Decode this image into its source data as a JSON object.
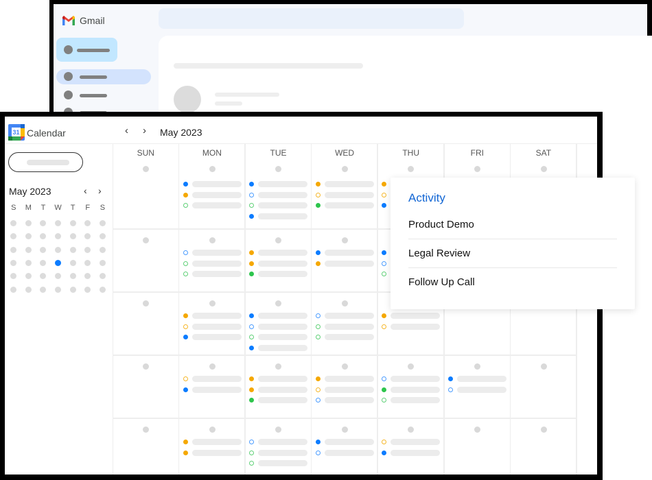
{
  "gmail": {
    "app_name": "Gmail",
    "icon": "gmail-logo-icon"
  },
  "calendar": {
    "app_name": "Calendar",
    "logo_day": "31",
    "header_month": "May 2023",
    "prev_label": "‹",
    "next_label": "›",
    "mini": {
      "month": "May 2023",
      "prev_label": "‹",
      "next_label": "›",
      "weekday_headers": [
        "S",
        "M",
        "T",
        "W",
        "T",
        "F",
        "S"
      ],
      "weeks": 6,
      "selected": {
        "week": 4,
        "weekday": 4
      }
    },
    "days": [
      "SUN",
      "MON",
      "TUE",
      "WED",
      "THU",
      "FRI",
      "SAT"
    ],
    "colors": {
      "blue": "#0b7cff",
      "orange": "#f5a800",
      "green": "#2ec54d",
      "blue_outline": "#4a9cff",
      "orange_outline": "#f5b72a",
      "green_outline": "#5fd077"
    },
    "weeks": [
      [
        [],
        [
          [
            "blue",
            "filled"
          ],
          [
            "orange",
            "filled"
          ],
          [
            "green",
            "outline"
          ]
        ],
        [
          [
            "blue",
            "filled"
          ],
          [
            "blue",
            "outline"
          ],
          [
            "green",
            "outline"
          ],
          [
            "blue",
            "filled"
          ]
        ],
        [
          [
            "orange",
            "filled"
          ],
          [
            "orange",
            "outline"
          ],
          [
            "green",
            "filled"
          ]
        ],
        [
          [
            "orange",
            "filled"
          ],
          [
            "orange",
            "outline"
          ],
          [
            "blue",
            "filled"
          ]
        ],
        [],
        []
      ],
      [
        [],
        [
          [
            "blue",
            "outline"
          ],
          [
            "green",
            "outline"
          ],
          [
            "green",
            "outline"
          ]
        ],
        [
          [
            "orange",
            "filled"
          ],
          [
            "orange",
            "filled"
          ],
          [
            "green",
            "filled"
          ]
        ],
        [
          [
            "blue",
            "filled"
          ],
          [
            "orange",
            "filled"
          ]
        ],
        [
          [
            "blue",
            "filled"
          ],
          [
            "blue",
            "outline"
          ],
          [
            "green",
            "outline"
          ]
        ],
        [],
        []
      ],
      [
        [],
        [
          [
            "orange",
            "filled"
          ],
          [
            "orange",
            "outline"
          ],
          [
            "blue",
            "filled"
          ]
        ],
        [
          [
            "blue",
            "filled"
          ],
          [
            "blue",
            "outline"
          ],
          [
            "green",
            "outline"
          ],
          [
            "blue",
            "filled"
          ]
        ],
        [
          [
            "blue",
            "outline"
          ],
          [
            "green",
            "outline"
          ],
          [
            "green",
            "outline"
          ]
        ],
        [
          [
            "orange",
            "filled"
          ],
          [
            "orange",
            "outline"
          ]
        ],
        [],
        []
      ],
      [
        [],
        [
          [
            "orange",
            "outline"
          ],
          [
            "blue",
            "filled"
          ]
        ],
        [
          [
            "orange",
            "filled"
          ],
          [
            "orange",
            "filled"
          ],
          [
            "green",
            "filled"
          ]
        ],
        [
          [
            "orange",
            "filled"
          ],
          [
            "orange",
            "outline"
          ],
          [
            "blue",
            "outline"
          ]
        ],
        [
          [
            "blue",
            "outline"
          ],
          [
            "green",
            "filled"
          ],
          [
            "green",
            "outline"
          ]
        ],
        [
          [
            "blue",
            "filled"
          ],
          [
            "blue",
            "outline"
          ]
        ],
        []
      ],
      [
        [],
        [
          [
            "orange",
            "filled"
          ],
          [
            "orange",
            "filled"
          ]
        ],
        [
          [
            "blue",
            "outline"
          ],
          [
            "green",
            "outline"
          ],
          [
            "green",
            "outline"
          ]
        ],
        [
          [
            "blue",
            "filled"
          ],
          [
            "blue",
            "outline"
          ]
        ],
        [
          [
            "orange",
            "outline"
          ],
          [
            "blue",
            "filled"
          ]
        ],
        [],
        []
      ]
    ]
  },
  "popup": {
    "title": "Activity",
    "items": [
      "Product Demo",
      "Legal Review",
      "Follow Up Call"
    ]
  }
}
